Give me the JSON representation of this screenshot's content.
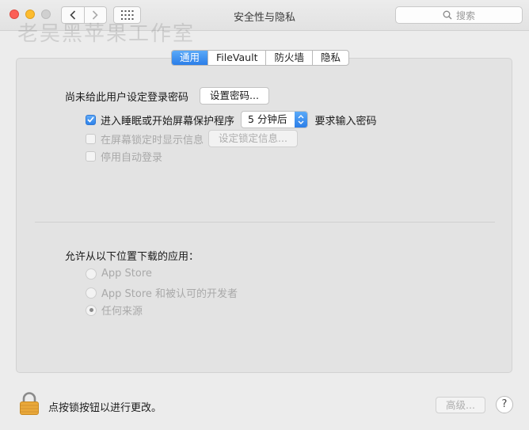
{
  "window": {
    "title": "安全性与隐私"
  },
  "toolbar": {
    "search_placeholder": "搜索"
  },
  "watermark": "老吴黑苹果工作室",
  "tabs": [
    {
      "label": "通用",
      "active": true
    },
    {
      "label": "FileVault",
      "active": false
    },
    {
      "label": "防火墙",
      "active": false
    },
    {
      "label": "隐私",
      "active": false
    }
  ],
  "general": {
    "password_label": "尚未给此用户设定登录密码",
    "set_password_button": "设置密码...",
    "require_password": {
      "label": "进入睡眠或开始屏幕保护程序",
      "checked": true,
      "delay_value": "5 分钟后",
      "suffix": "要求输入密码"
    },
    "show_message": {
      "label": "在屏幕锁定时显示信息",
      "checked": false,
      "disabled": true,
      "button": "设定锁定信息..."
    },
    "disable_autologin": {
      "label": "停用自动登录",
      "checked": false,
      "disabled": true
    }
  },
  "downloads": {
    "heading": "允许从以下位置下载的应用：",
    "options": [
      {
        "label": "App Store",
        "selected": false
      },
      {
        "label": "App Store 和被认可的开发者",
        "selected": false
      },
      {
        "label": "任何来源",
        "selected": true
      }
    ]
  },
  "footer": {
    "lock_text": "点按锁按钮以进行更改。",
    "advanced_button": "高级...",
    "help_button": "?"
  },
  "colors": {
    "accent": "#2b7ee8",
    "lock": "#e9a83a"
  }
}
